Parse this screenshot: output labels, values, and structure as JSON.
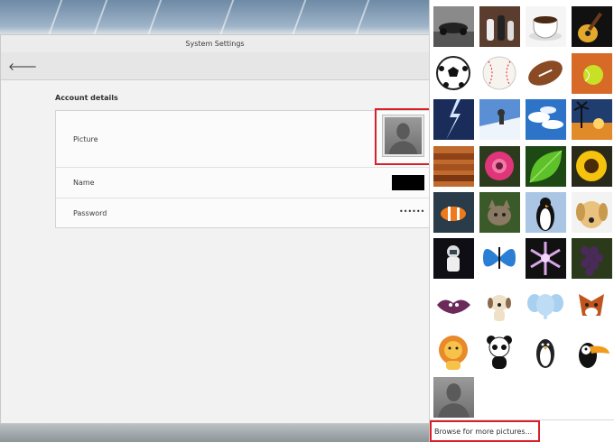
{
  "window": {
    "title": "System Settings"
  },
  "account": {
    "section_title": "Account details",
    "picture_label": "Picture",
    "name_label": "Name",
    "password_label": "Password",
    "password_value": "••••••"
  },
  "picker": {
    "items": [
      "race-car",
      "chess-pieces",
      "coffee-cup",
      "guitar",
      "soccer-ball",
      "baseball",
      "football",
      "tennis-ball",
      "lightning",
      "snowboarder",
      "clouds",
      "sunset-beach",
      "cinnamon-sticks",
      "pink-flower",
      "green-leaf",
      "sunflower",
      "clownfish",
      "kitten",
      "penguin",
      "puppy",
      "astronaut",
      "butterfly",
      "snowflake",
      "grapes",
      "cartoon-bat",
      "cartoon-dog",
      "cartoon-elephant",
      "cartoon-fox",
      "cartoon-lion",
      "cartoon-panda",
      "cartoon-penguin",
      "cartoon-toucan",
      "default-avatar"
    ],
    "browse_label": "Browse for more pictures..."
  },
  "colors": {
    "highlight": "#d9202a",
    "window_bg": "#f2f2f2"
  }
}
